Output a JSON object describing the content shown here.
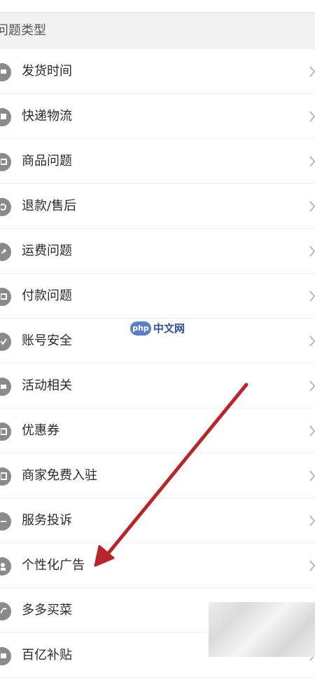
{
  "section": {
    "title": "问题类型"
  },
  "items": [
    {
      "label": "发货时间",
      "icon": "truck-icon"
    },
    {
      "label": "快递物流",
      "icon": "package-icon"
    },
    {
      "label": "商品问题",
      "icon": "box-icon"
    },
    {
      "label": "退款/售后",
      "icon": "refund-icon"
    },
    {
      "label": "运费问题",
      "icon": "shipping-fee-icon"
    },
    {
      "label": "付款问题",
      "icon": "wallet-icon"
    },
    {
      "label": "账号安全",
      "icon": "shield-icon"
    },
    {
      "label": "活动相关",
      "icon": "gift-icon"
    },
    {
      "label": "优惠券",
      "icon": "coupon-icon"
    },
    {
      "label": "商家免费入驻",
      "icon": "store-icon"
    },
    {
      "label": "服务投诉",
      "icon": "complaint-icon"
    },
    {
      "label": "个性化广告",
      "icon": "user-icon"
    },
    {
      "label": "多多买菜",
      "icon": "vegetable-icon"
    },
    {
      "label": "百亿补贴",
      "icon": "subsidy-icon"
    }
  ],
  "watermark": {
    "badge": "php",
    "text": "中文网"
  },
  "colors": {
    "accent_arrow": "#b8262a",
    "icon_gray": "#8a8a8a",
    "header_bg": "#f2f2f2"
  }
}
